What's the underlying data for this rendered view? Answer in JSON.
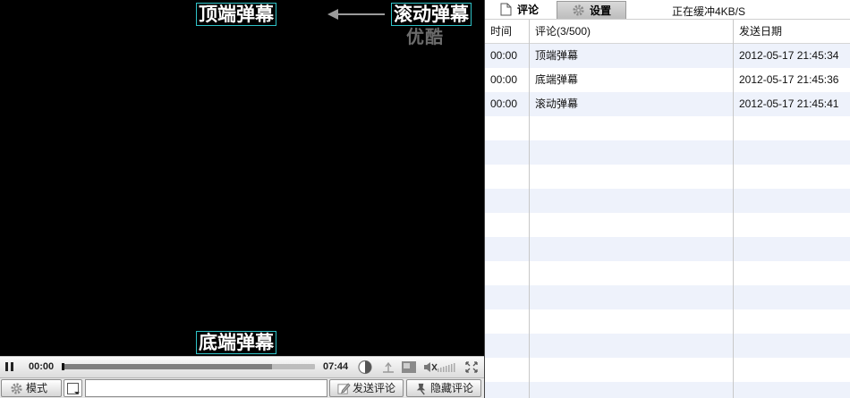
{
  "video": {
    "danmaku_top": "顶端弹幕",
    "danmaku_bottom": "底端弹幕",
    "danmaku_scroll": "滚动弹幕",
    "logo_text": "优酷"
  },
  "player": {
    "current_time": "00:00",
    "total_time": "07:44",
    "progress_fraction": 0.83,
    "volume_level": 0.0,
    "muted": true
  },
  "input_bar": {
    "mode_label": "模式",
    "comment_placeholder": "",
    "comment_value": "",
    "send_label": "发送评论",
    "hide_label": "隐藏评论"
  },
  "panel": {
    "tabs": [
      {
        "label": "评论",
        "icon": "document-icon",
        "active": true
      },
      {
        "label": "设置",
        "icon": "gear-icon",
        "active": false
      }
    ],
    "buffer_status": "正在缓冲4KB/S",
    "columns": {
      "time": "时间",
      "comment": "评论(3/500)",
      "date": "发送日期"
    },
    "rows": [
      {
        "time": "00:00",
        "text": "顶端弹幕",
        "date": "2012-05-17 21:45:34"
      },
      {
        "time": "00:00",
        "text": "底端弹幕",
        "date": "2012-05-17 21:45:36"
      },
      {
        "time": "00:00",
        "text": "滚动弹幕",
        "date": "2012-05-17 21:45:41"
      }
    ],
    "empty_row_count": 12
  },
  "colors": {
    "danmaku_border": "#2fc3c8",
    "row_stripe": "#eef2fb",
    "video_bg": "#000000"
  }
}
